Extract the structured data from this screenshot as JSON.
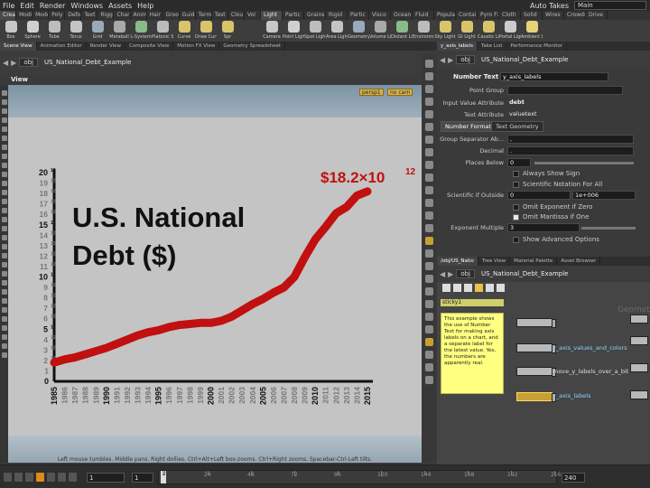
{
  "menu": [
    "File",
    "Edit",
    "Render",
    "Windows",
    "Assets",
    "Help"
  ],
  "menu_right": {
    "auto_takes": "Auto Takes",
    "desktop": "Main"
  },
  "shelf_left": {
    "tabs": [
      "Create",
      "Modify",
      "Model",
      "Poly",
      "Deform",
      "Text",
      "Rigg",
      "Char",
      "Anim",
      "Hair",
      "Groo",
      "Guid",
      "Term",
      "Test",
      "Clou",
      "Vol"
    ],
    "tools": [
      "Box",
      "Sphere",
      "Tube",
      "Torus",
      "Grid",
      "Metaball",
      "L-System",
      "Platonic Sol",
      "Curve",
      "Draw Curve",
      "Spr"
    ]
  },
  "shelf_right": {
    "tabs": [
      "Light",
      "Partic",
      "Grains",
      "Rigid",
      "Partic",
      "Visco",
      "Ocean",
      "Fluid",
      "Popula",
      "Contai",
      "Pyro FX",
      "Cloth",
      "Solid",
      "Wires",
      "Crowds",
      "Drive"
    ],
    "tools": [
      "Camera",
      "Point Light",
      "Spot Light",
      "Area Light",
      "Geometry L",
      "Volume Light",
      "Distant Light",
      "Environme",
      "Sky Light",
      "GI Light",
      "Caustic Light",
      "Portal Light",
      "Ambient Lig"
    ]
  },
  "left_pane_tabs": [
    "Scene View",
    "Animation Editor",
    "Render View",
    "Composite View",
    "Motion FX View",
    "Geometry Spreadsheet"
  ],
  "left_path": {
    "root": "obj",
    "node": "US_National_Debt_Example"
  },
  "viewport": {
    "title": "View",
    "persp": "persp1",
    "cam": "no cam",
    "status": "Left mouse tumbles. Middle pans. Right dollies. Ctrl+Alt+Left box-zooms. Ctrl+Right zooms. Spacebar-Ctrl-Left tilts."
  },
  "chart_data": {
    "type": "line",
    "title_lines": [
      "U.S. National",
      "Debt ($)"
    ],
    "annotation": "$18.2×10",
    "annotation_exp": "12",
    "x": [
      1985,
      1986,
      1987,
      1988,
      1989,
      1990,
      1991,
      1992,
      1993,
      1994,
      1995,
      1996,
      1997,
      1998,
      1999,
      2000,
      2001,
      2002,
      2003,
      2004,
      2005,
      2006,
      2007,
      2008,
      2009,
      2010,
      2011,
      2012,
      2013,
      2014,
      2015
    ],
    "values": [
      1.8,
      2.1,
      2.3,
      2.6,
      2.9,
      3.2,
      3.6,
      4.0,
      4.4,
      4.7,
      4.9,
      5.2,
      5.4,
      5.5,
      5.6,
      5.6,
      5.8,
      6.2,
      6.8,
      7.4,
      7.9,
      8.5,
      9.0,
      10.0,
      11.9,
      13.6,
      14.8,
      16.1,
      16.7,
      17.8,
      18.2
    ],
    "xlim": [
      1985,
      2015
    ],
    "ylim": [
      0,
      20
    ],
    "y_ticks": [
      0,
      1,
      2,
      3,
      4,
      5,
      6,
      7,
      8,
      9,
      10,
      11,
      12,
      13,
      14,
      15,
      16,
      17,
      18,
      19,
      20
    ],
    "y_tick_exp": "12",
    "color": "#c0100f"
  },
  "right_top_tabs": [
    "y_axis_labels",
    "Take List",
    "Performance Monitor"
  ],
  "right_top_path": {
    "root": "obj",
    "node": "US_National_Debt_Example"
  },
  "param": {
    "node_type": "Number Text",
    "node_name": "y_axis_labels",
    "point_group_label": "Point Group",
    "input_attr_label": "Input Value Attribute",
    "input_attr_value": "debt",
    "text_attr_label": "Text Attribute",
    "text_attr_value": "valuetext",
    "tabs": [
      "Number Format",
      "Text Geometry"
    ],
    "group_sep_label": "Group Separator Ab...",
    "group_sep_value": ",",
    "decimal_label": "Decimal",
    "decimal_value": ".",
    "places_label": "Places Below",
    "places_value": "0",
    "always_sign": "Always Show Sign",
    "sci_all": "Scientific Notation For All",
    "sci_outside_label": "Scientific if Outside",
    "sci_outside_min": "0",
    "sci_outside_max": "1e+006",
    "omit_exp": "Omit Exponent if Zero",
    "omit_mant": "Omit Mantissa if One",
    "exp_mult_label": "Exponent Multiple",
    "exp_mult_value": "3",
    "show_adv": "Show Advanced Options"
  },
  "net_tabs": [
    "/obj/US_Natio",
    "Tree View",
    "Material Palette",
    "Asset Browser"
  ],
  "net_path": {
    "root": "obj",
    "node": "US_National_Debt_Example"
  },
  "net": {
    "sticky_title": "sticky1",
    "sticky_text": "This example shows the use of Number Text for making axis labels on a chart, and a separate label for the latest value.  Yes, the numbers are apparently real.",
    "node1": "y_axis_values_and_colors",
    "node2": "move_y_labels_over_a_bit",
    "node3": "y_axis_labels",
    "watermark": "Geometry"
  },
  "timeline": {
    "frame": "1",
    "start": "1",
    "end": "240",
    "ruler_labels": [
      "1",
      "24",
      "48",
      "72",
      "96",
      "120",
      "144",
      "168",
      "192",
      "216"
    ]
  }
}
